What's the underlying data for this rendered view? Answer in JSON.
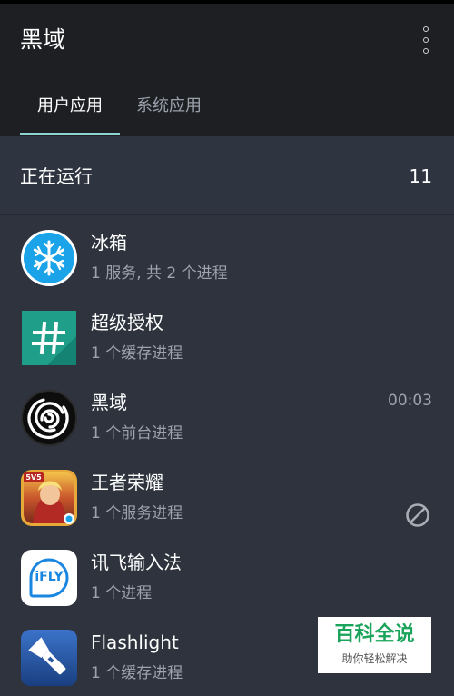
{
  "app": {
    "title": "黑域"
  },
  "tabs": [
    {
      "label": "用户应用",
      "active": true
    },
    {
      "label": "系统应用",
      "active": false
    }
  ],
  "section": {
    "label": "正在运行",
    "count": "11"
  },
  "apps": [
    {
      "name": "冰箱",
      "status": "1 服务, 共 2 个进程",
      "icon": "snowflake-icon"
    },
    {
      "name": "超级授权",
      "status": "1 个缓存进程",
      "icon": "hash-icon"
    },
    {
      "name": "黑域",
      "status": "1 个前台进程",
      "time": "00:03",
      "icon": "spiral-icon"
    },
    {
      "name": "王者荣耀",
      "status": "1 个服务进程",
      "icon": "game-icon",
      "badge": "5V5"
    },
    {
      "name": "讯飞输入法",
      "status": "1 个进程",
      "icon": "ifly-icon",
      "icon_text": "iFLY"
    },
    {
      "name": "Flashlight",
      "status": "1 个缓存进程",
      "icon": "flashlight-icon"
    }
  ],
  "watermark": {
    "title": "百科全说",
    "subtitle": "助你轻松解决"
  },
  "colors": {
    "topbar": "#1e1f23",
    "background": "#2e333d",
    "tab_indicator": "#8fd3d5",
    "secondary_text": "#9ca3ad"
  }
}
